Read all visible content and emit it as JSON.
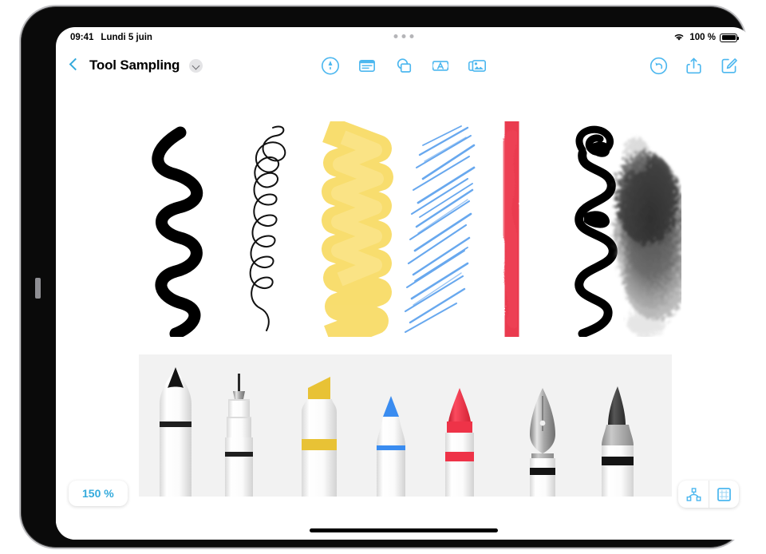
{
  "status_bar": {
    "time": "09:41",
    "date": "Lundi 5 juin",
    "wifi_icon": "wifi-icon",
    "battery_text": "100 %",
    "battery_icon": "battery-icon",
    "multitask_handle": "multitask-dots"
  },
  "nav_bar": {
    "back_label": "back-chevron",
    "title": "Tool Sampling",
    "title_chevron": "chevron-down-icon",
    "center_tools": [
      {
        "name": "markup-pen-tool",
        "label": "Markup"
      },
      {
        "name": "document-text-tool",
        "label": "Document"
      },
      {
        "name": "shapes-tool",
        "label": "Shapes"
      },
      {
        "name": "text-box-tool",
        "label": "Text"
      },
      {
        "name": "media-tool",
        "label": "Media"
      }
    ],
    "right_tools": [
      {
        "name": "undo-button",
        "label": "Undo"
      },
      {
        "name": "share-button",
        "label": "Share"
      },
      {
        "name": "compose-button",
        "label": "Compose"
      }
    ]
  },
  "canvas": {
    "strokes": [
      {
        "name": "stroke-thick-black-pen",
        "tool": "pen",
        "color": "#000000"
      },
      {
        "name": "stroke-thin-black-liner",
        "tool": "fine-liner",
        "color": "#111111"
      },
      {
        "name": "stroke-yellow-highlighter",
        "tool": "highlighter",
        "color": "#f6d44a"
      },
      {
        "name": "stroke-blue-pencil",
        "tool": "pencil",
        "color": "#2f87e8"
      },
      {
        "name": "stroke-red-crayon",
        "tool": "crayon",
        "color": "#e8283c"
      },
      {
        "name": "stroke-black-fountain-pen",
        "tool": "fountain-pen",
        "color": "#000000"
      },
      {
        "name": "stroke-charcoal-brush",
        "tool": "brush",
        "color": "#3c3c3c"
      }
    ],
    "pens": [
      {
        "name": "pen-black-marker",
        "tip_color": "#1a1a1a",
        "band_color": "#1f1f1f",
        "body": "#fbfbfb"
      },
      {
        "name": "pen-fine-liner",
        "tip_color": "#3a3a3a",
        "band_color": "#1f1f1f",
        "body": "#fbfbfb"
      },
      {
        "name": "pen-yellow-highlighter",
        "tip_color": "#e8c235",
        "band_color": "#e8c235",
        "body": "#fbfbfb"
      },
      {
        "name": "pen-blue-pencil",
        "tip_color": "#3a8cf0",
        "band_color": "#3a8cf0",
        "body": "#fbfbfb"
      },
      {
        "name": "pen-red-crayon",
        "tip_color": "#ee3348",
        "band_color": "#ee3348",
        "body": "#fbfbfb"
      },
      {
        "name": "pen-fountain-nib",
        "tip_color": "#9b9b9b",
        "band_color": "#1a1a1a",
        "body": "#fbfbfb"
      },
      {
        "name": "pen-charcoal-brush",
        "tip_color": "#3d3d3d",
        "band_color": "#1a1a1a",
        "body": "#fbfbfb"
      }
    ],
    "panel_background": "#f2f2f2"
  },
  "bottom_bar": {
    "zoom_level": "150 %",
    "view_buttons": [
      {
        "name": "path-nodes-button",
        "label": "Nodes"
      },
      {
        "name": "page-grid-button",
        "label": "Page"
      }
    ],
    "home_indicator": "home-indicator"
  },
  "theme": {
    "accent": "#34aadc",
    "canvas_bg": "#ffffff",
    "panel_bg": "#f2f2f2",
    "frame": "#0a0a0a"
  }
}
